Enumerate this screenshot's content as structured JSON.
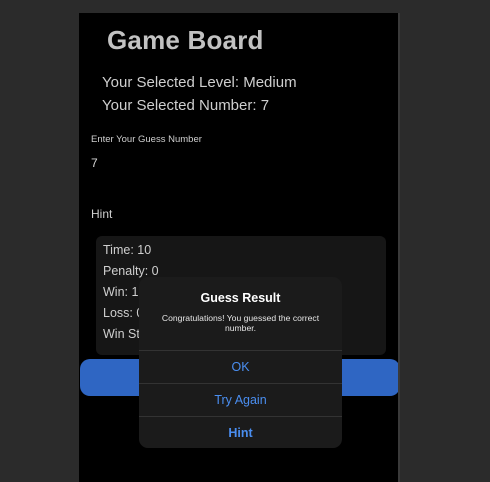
{
  "page": {
    "title": "Game Board",
    "selected_level": "Your Selected Level: Medium",
    "selected_number": "Your Selected Number: 7",
    "guess_label": "Enter Your Guess Number",
    "guess_value": "7",
    "hint_label": "Hint"
  },
  "stats": [
    "Time: 10",
    "Penalty: 0",
    "Win: 1",
    "Loss: 0",
    "Win Streak"
  ],
  "dialog": {
    "title": "Guess Result",
    "message": "Congratulations! You guessed the correct number.",
    "buttons": [
      "OK",
      "Try Again",
      "Hint"
    ]
  },
  "colors": {
    "accent": "#2f66c3",
    "dialog_button_text": "#4a8ef0",
    "background": "#000000"
  }
}
